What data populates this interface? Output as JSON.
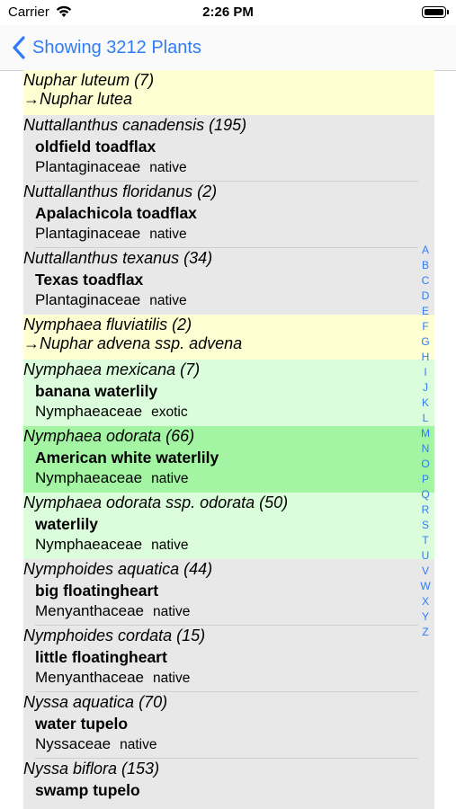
{
  "status_bar": {
    "carrier": "Carrier",
    "time": "2:26 PM"
  },
  "nav": {
    "back_label": "Showing 3212 Plants"
  },
  "rows": [
    {
      "kind": "redirect",
      "color": "yellow",
      "scientific": "Nuphar luteum  (7)",
      "target": "→Nuphar lutea"
    },
    {
      "kind": "plant",
      "color": "gray",
      "scientific": "Nuttallanthus canadensis  (195)",
      "common": "oldfield toadflax",
      "family": "Plantaginaceae",
      "status": "native"
    },
    {
      "kind": "plant",
      "color": "gray",
      "scientific": "Nuttallanthus floridanus  (2)",
      "common": "Apalachicola toadflax",
      "family": "Plantaginaceae",
      "status": "native"
    },
    {
      "kind": "plant",
      "color": "gray",
      "scientific": "Nuttallanthus texanus  (34)",
      "common": "Texas toadflax",
      "family": "Plantaginaceae",
      "status": "native"
    },
    {
      "kind": "redirect",
      "color": "yellow",
      "scientific": "Nymphaea fluviatilis  (2)",
      "target": "→Nuphar advena ssp. advena"
    },
    {
      "kind": "plant",
      "color": "lightgreen",
      "scientific": "Nymphaea mexicana  (7)",
      "common": "banana waterlily",
      "family": "Nymphaeaceae",
      "status": "exotic"
    },
    {
      "kind": "plant",
      "color": "green",
      "scientific": "Nymphaea odorata  (66)",
      "common": "American white waterlily",
      "family": "Nymphaeaceae",
      "status": "native"
    },
    {
      "kind": "plant",
      "color": "lightgreen",
      "scientific": "Nymphaea odorata ssp. odorata  (50)",
      "common": "waterlily",
      "family": "Nymphaeaceae",
      "status": "native"
    },
    {
      "kind": "plant",
      "color": "gray",
      "scientific": "Nymphoides aquatica  (44)",
      "common": "big floatingheart",
      "family": "Menyanthaceae",
      "status": "native"
    },
    {
      "kind": "plant",
      "color": "gray",
      "scientific": "Nymphoides cordata  (15)",
      "common": "little floatingheart",
      "family": "Menyanthaceae",
      "status": "native"
    },
    {
      "kind": "plant",
      "color": "gray",
      "scientific": "Nyssa aquatica  (70)",
      "common": "water tupelo",
      "family": "Nyssaceae",
      "status": "native"
    },
    {
      "kind": "plant",
      "color": "gray",
      "scientific": "Nyssa biflora  (153)",
      "common": "swamp tupelo",
      "family": "",
      "status": ""
    }
  ],
  "index_letters": [
    "A",
    "B",
    "C",
    "D",
    "E",
    "F",
    "G",
    "H",
    "I",
    "J",
    "K",
    "L",
    "M",
    "N",
    "O",
    "P",
    "Q",
    "R",
    "S",
    "T",
    "U",
    "V",
    "W",
    "X",
    "Y",
    "Z"
  ],
  "colors": {
    "accent": "#2f7cf6",
    "redirect_bg": "#ffffd4",
    "plant_bg": "#e8e8e8",
    "highlight_bg": "#a3f5a3",
    "light_green_bg": "#dcfddc"
  }
}
